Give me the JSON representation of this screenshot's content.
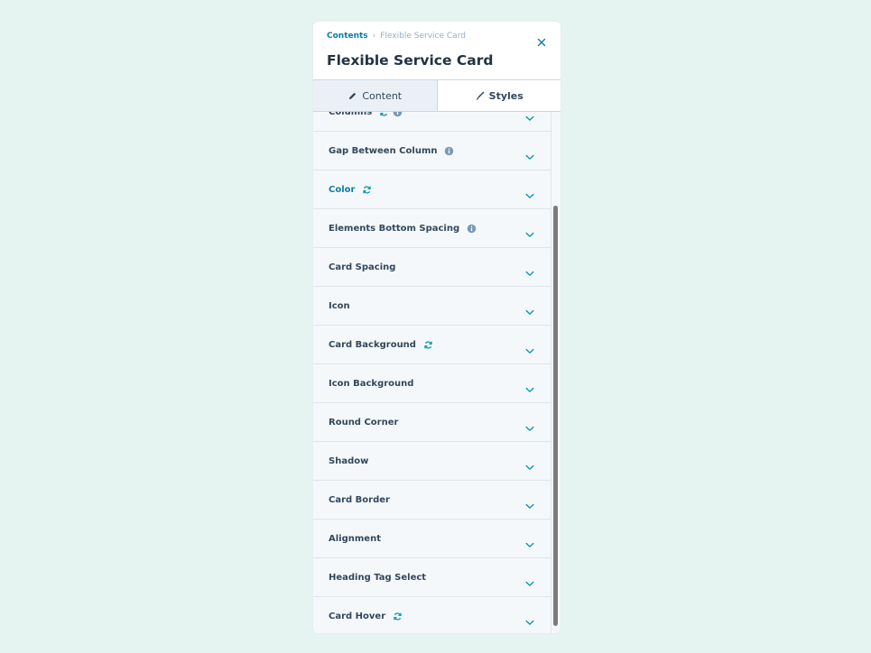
{
  "breadcrumb": {
    "parent": "Contents",
    "separator": "›",
    "current": "Flexible Service Card"
  },
  "title": "Flexible Service Card",
  "tabs": [
    {
      "label": "Content",
      "icon": "pencil-icon",
      "active": false
    },
    {
      "label": "Styles",
      "icon": "brush-icon",
      "active": true
    }
  ],
  "rows": [
    {
      "label": "Columns",
      "icons": [
        "sync-icon",
        "info-icon"
      ]
    },
    {
      "label": "Gap Between Column",
      "icons": [
        "info-icon"
      ]
    },
    {
      "label": "Color",
      "icons": [
        "sync-icon"
      ],
      "accent": true
    },
    {
      "label": "Elements Bottom Spacing",
      "icons": [
        "info-icon"
      ]
    },
    {
      "label": "Card Spacing",
      "icons": []
    },
    {
      "label": "Icon",
      "icons": []
    },
    {
      "label": "Card Background",
      "icons": [
        "sync-icon"
      ]
    },
    {
      "label": "Icon Background",
      "icons": []
    },
    {
      "label": "Round Corner",
      "icons": []
    },
    {
      "label": "Shadow",
      "icons": []
    },
    {
      "label": "Card Border",
      "icons": []
    },
    {
      "label": "Alignment",
      "icons": []
    },
    {
      "label": "Heading Tag Select",
      "icons": []
    },
    {
      "label": "Card Hover",
      "icons": [
        "sync-icon"
      ]
    }
  ],
  "colors": {
    "background": "#e6f4f1",
    "accent": "#0b7ea3",
    "text": "#33475b",
    "title": "#213343",
    "muted": "#99acc2",
    "chevron": "#0091ae",
    "info": "#7c98b6"
  }
}
